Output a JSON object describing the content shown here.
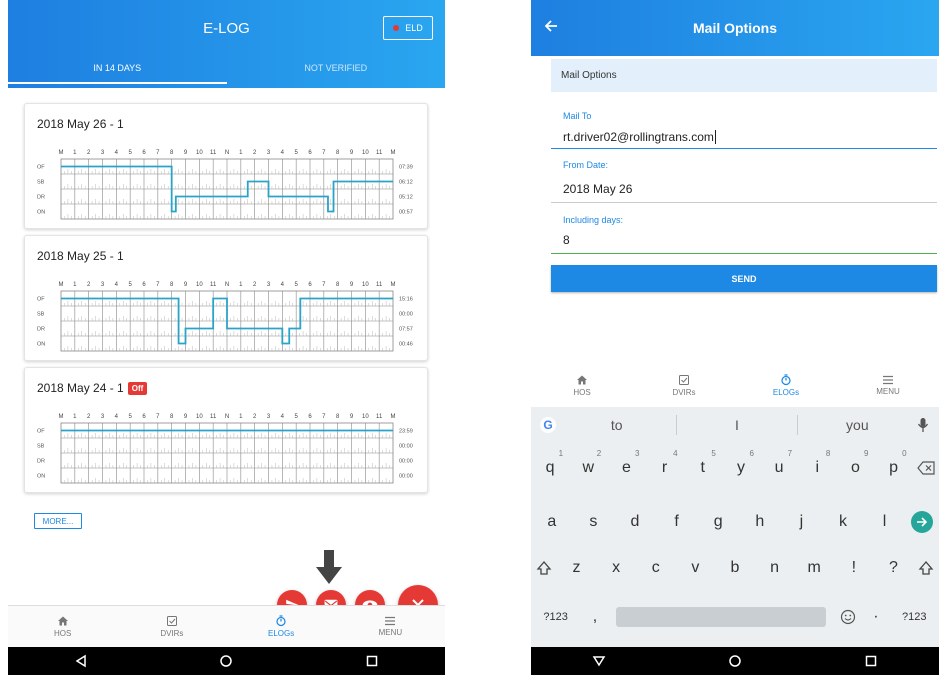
{
  "left": {
    "header": {
      "title": "E-LOG",
      "eld_label": "ELD"
    },
    "tabs": [
      {
        "label": "IN 14 DAYS"
      },
      {
        "label": "NOT VERIFIED"
      }
    ],
    "grid_hour_labels": [
      "M",
      "1",
      "2",
      "3",
      "4",
      "5",
      "6",
      "7",
      "8",
      "9",
      "10",
      "11",
      "N",
      "1",
      "2",
      "3",
      "4",
      "5",
      "6",
      "7",
      "8",
      "9",
      "10",
      "11",
      "M"
    ],
    "grid_row_labels": [
      "OF",
      "SB",
      "DR",
      "ON"
    ],
    "logs": [
      {
        "title": "2018 May 26 - 1",
        "badge": "",
        "totals": [
          "07:39",
          "06:12",
          "05:12",
          "00:57"
        ],
        "segments": [
          [
            0,
            8,
            0
          ],
          [
            8,
            8.3,
            3
          ],
          [
            8.3,
            13.5,
            2
          ],
          [
            13.5,
            15,
            1
          ],
          [
            15,
            19.3,
            2
          ],
          [
            19.3,
            19.7,
            3
          ],
          [
            19.7,
            24,
            1
          ]
        ]
      },
      {
        "title": "2018 May 25 - 1",
        "badge": "",
        "totals": [
          "15:16",
          "00:00",
          "07:57",
          "00:46"
        ],
        "segments": [
          [
            0,
            8.5,
            0
          ],
          [
            8.5,
            9,
            3
          ],
          [
            9,
            11,
            2
          ],
          [
            11,
            12,
            0
          ],
          [
            12,
            16,
            2
          ],
          [
            16,
            16.5,
            3
          ],
          [
            16.5,
            17.3,
            2
          ],
          [
            17.3,
            24,
            0
          ]
        ]
      },
      {
        "title": "2018 May 24 - 1",
        "badge": "Off",
        "totals": [
          "23:59",
          "00:00",
          "00:00",
          "00:00"
        ],
        "segments": [
          [
            0,
            24,
            0
          ]
        ]
      }
    ],
    "more_label": "MORE...",
    "nav": [
      {
        "label": "HOS",
        "icon": "home-icon"
      },
      {
        "label": "DVIRs",
        "icon": "checkbox-icon"
      },
      {
        "label": "ELOGs",
        "icon": "timer-icon"
      },
      {
        "label": "MENU",
        "icon": "menu-icon"
      }
    ]
  },
  "right": {
    "header": {
      "title": "Mail Options"
    },
    "section_title": "Mail Options",
    "mail_to": {
      "label": "Mail To",
      "value": "rt.driver02@rollingtrans.com"
    },
    "from_date": {
      "label": "From Date:",
      "value": "2018 May 26"
    },
    "including_days": {
      "label": "Including days:",
      "value": "8"
    },
    "send_label": "SEND",
    "nav": [
      {
        "label": "HOS",
        "icon": "home-icon"
      },
      {
        "label": "DVIRs",
        "icon": "checkbox-icon"
      },
      {
        "label": "ELOGs",
        "icon": "timer-icon"
      },
      {
        "label": "MENU",
        "icon": "menu-icon"
      }
    ],
    "keyboard": {
      "suggestions": [
        "to",
        "I",
        "you"
      ],
      "row1": [
        [
          "q",
          "1"
        ],
        [
          "w",
          "2"
        ],
        [
          "e",
          "3"
        ],
        [
          "r",
          "4"
        ],
        [
          "t",
          "5"
        ],
        [
          "y",
          "6"
        ],
        [
          "u",
          "7"
        ],
        [
          "i",
          "8"
        ],
        [
          "o",
          "9"
        ],
        [
          "p",
          "0"
        ]
      ],
      "row2": [
        "a",
        "s",
        "d",
        "f",
        "g",
        "h",
        "j",
        "k",
        "l"
      ],
      "row3": [
        "z",
        "x",
        "c",
        "v",
        "b",
        "n",
        "m",
        "!",
        "?"
      ],
      "symbols_label": "?123",
      "comma": ",",
      "period": "·",
      "symbols_label_right": "?123"
    }
  }
}
